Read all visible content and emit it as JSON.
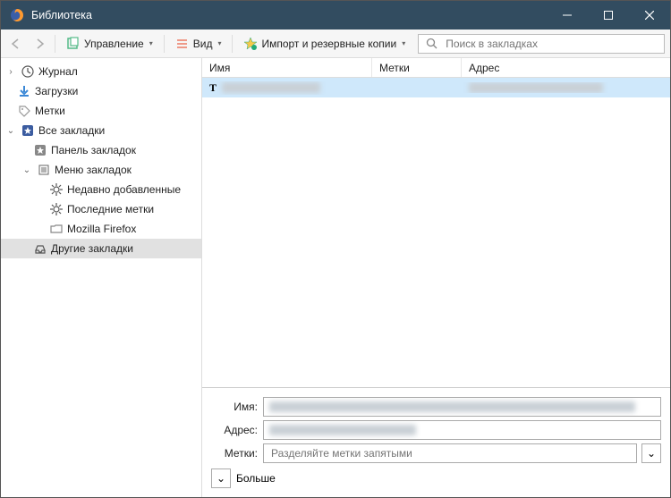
{
  "window": {
    "title": "Библиотека"
  },
  "toolbar": {
    "manage": "Управление",
    "view": "Вид",
    "import": "Импорт и резервные копии",
    "search_placeholder": "Поиск в закладках"
  },
  "sidebar": {
    "history": "Журнал",
    "downloads": "Загрузки",
    "tags": "Метки",
    "all_bookmarks": "Все закладки",
    "bookmarks_toolbar": "Панель закладок",
    "bookmarks_menu": "Меню закладок",
    "recently_added": "Недавно добавленные",
    "recent_tags": "Последние метки",
    "mozilla_firefox": "Mozilla Firefox",
    "other_bookmarks": "Другие закладки"
  },
  "columns": {
    "name": "Имя",
    "tags": "Метки",
    "address": "Адрес"
  },
  "rows": [
    {
      "icon": "T",
      "name_redacted": true,
      "address_redacted": true
    }
  ],
  "details": {
    "name_label": "Имя:",
    "address_label": "Адрес:",
    "tags_label": "Метки:",
    "tags_placeholder": "Разделяйте метки запятыми",
    "more": "Больше"
  }
}
